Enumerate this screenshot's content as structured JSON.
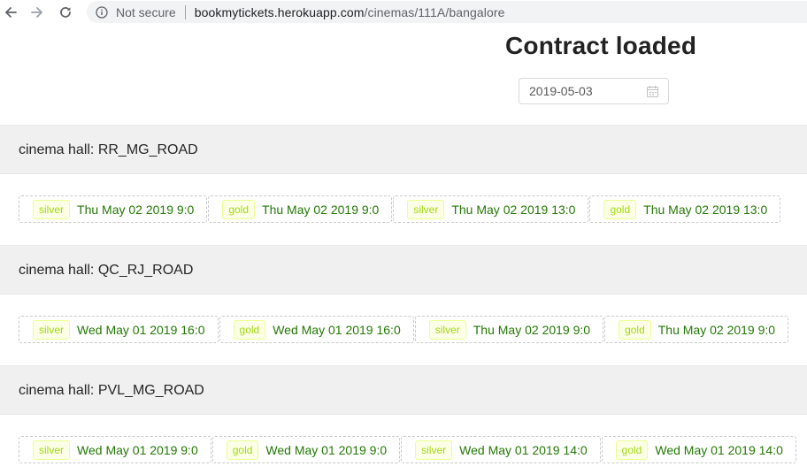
{
  "browser": {
    "security_label": "Not secure",
    "url_host": "bookmytickets.herokuapp.com",
    "url_path": "/cinemas/111A/bangalore"
  },
  "page": {
    "title": "Contract loaded",
    "date_value": "2019-05-03"
  },
  "colors": {
    "tag_text": "#a0d911",
    "tag_bg": "#fcffe6",
    "tag_border": "#eaff8f",
    "show_time_text": "#237804",
    "header_bg": "#f0f0f0"
  },
  "halls": [
    {
      "label": "cinema hall: RR_MG_ROAD",
      "shows": [
        {
          "tier": "silver",
          "time": "Thu May 02 2019 9:0"
        },
        {
          "tier": "gold",
          "time": "Thu May 02 2019 9:0"
        },
        {
          "tier": "silver",
          "time": "Thu May 02 2019 13:0"
        },
        {
          "tier": "gold",
          "time": "Thu May 02 2019 13:0"
        }
      ]
    },
    {
      "label": "cinema hall: QC_RJ_ROAD",
      "shows": [
        {
          "tier": "silver",
          "time": "Wed May 01 2019 16:0"
        },
        {
          "tier": "gold",
          "time": "Wed May 01 2019 16:0"
        },
        {
          "tier": "silver",
          "time": "Thu May 02 2019 9:0"
        },
        {
          "tier": "gold",
          "time": "Thu May 02 2019 9:0"
        }
      ]
    },
    {
      "label": "cinema hall: PVL_MG_ROAD",
      "shows": [
        {
          "tier": "silver",
          "time": "Wed May 01 2019 9:0"
        },
        {
          "tier": "gold",
          "time": "Wed May 01 2019 9:0"
        },
        {
          "tier": "silver",
          "time": "Wed May 01 2019 14:0"
        },
        {
          "tier": "gold",
          "time": "Wed May 01 2019 14:0"
        }
      ]
    }
  ]
}
